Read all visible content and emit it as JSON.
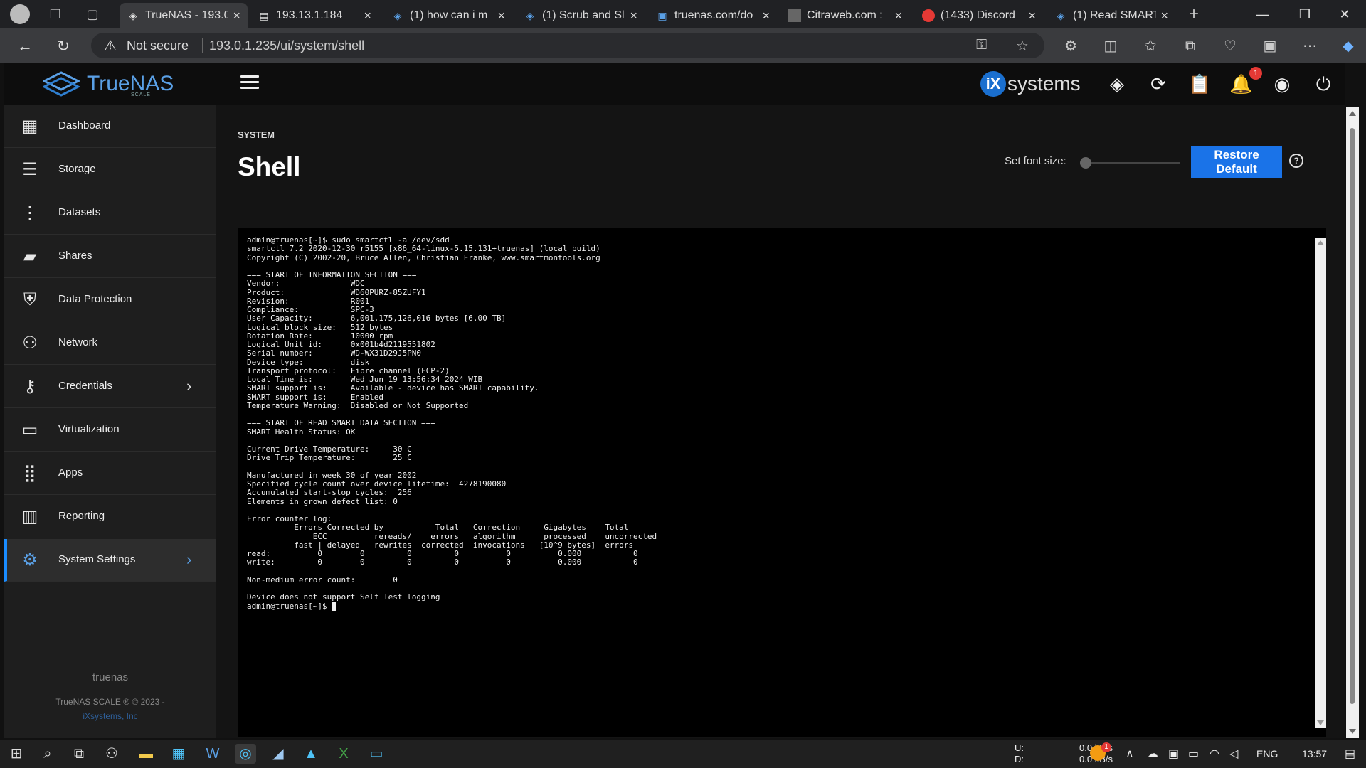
{
  "browser": {
    "tabs": [
      {
        "title": "TrueNAS - 193.0"
      },
      {
        "title": "193.13.1.184"
      },
      {
        "title": "(1) how can i m"
      },
      {
        "title": "(1) Scrub and Sl"
      },
      {
        "title": "truenas.com/do"
      },
      {
        "title": "Citraweb.com :"
      },
      {
        "title": "(1433) Discord"
      },
      {
        "title": "(1) Read SMART"
      }
    ],
    "not_secure": "Not secure",
    "url": "193.0.1.235/ui/system/shell"
  },
  "app": {
    "brand": "TrueNAS",
    "brand_sub": "SCALE",
    "partner_mark": "iX",
    "partner_text": "systems",
    "notification_count": "1"
  },
  "sidebar": {
    "items": [
      {
        "label": "Dashboard"
      },
      {
        "label": "Storage"
      },
      {
        "label": "Datasets"
      },
      {
        "label": "Shares"
      },
      {
        "label": "Data Protection"
      },
      {
        "label": "Network"
      },
      {
        "label": "Credentials"
      },
      {
        "label": "Virtualization"
      },
      {
        "label": "Apps"
      },
      {
        "label": "Reporting"
      },
      {
        "label": "System Settings"
      }
    ],
    "hostname": "truenas",
    "copyright": "TrueNAS SCALE ® © 2023 -",
    "company": "iXsystems, Inc"
  },
  "page": {
    "section": "SYSTEM",
    "title": "Shell",
    "font_size_label": "Set font size:",
    "font_size_level": 0,
    "restore_label": "Restore Default",
    "help_glyph": "?"
  },
  "terminal": {
    "output": "admin@truenas[~]$ sudo smartctl -a /dev/sdd\nsmartctl 7.2 2020-12-30 r5155 [x86_64-linux-5.15.131+truenas] (local build)\nCopyright (C) 2002-20, Bruce Allen, Christian Franke, www.smartmontools.org\n\n=== START OF INFORMATION SECTION ===\nVendor:               WDC\nProduct:              WD60PURZ-85ZUFY1\nRevision:             R001\nCompliance:           SPC-3\nUser Capacity:        6,001,175,126,016 bytes [6.00 TB]\nLogical block size:   512 bytes\nRotation Rate:        10000 rpm\nLogical Unit id:      0x001b4d2119551802\nSerial number:        WD-WX31D29J5PN0\nDevice type:          disk\nTransport protocol:   Fibre channel (FCP-2)\nLocal Time is:        Wed Jun 19 13:56:34 2024 WIB\nSMART support is:     Available - device has SMART capability.\nSMART support is:     Enabled\nTemperature Warning:  Disabled or Not Supported\n\n=== START OF READ SMART DATA SECTION ===\nSMART Health Status: OK\n\nCurrent Drive Temperature:     30 C\nDrive Trip Temperature:        25 C\n\nManufactured in week 30 of year 2002\nSpecified cycle count over device lifetime:  4278190080\nAccumulated start-stop cycles:  256\nElements in grown defect list: 0\n\nError counter log:\n          Errors Corrected by           Total   Correction     Gigabytes    Total\n              ECC          rereads/    errors   algorithm      processed    uncorrected\n          fast | delayed   rewrites  corrected  invocations   [10^9 bytes]  errors\nread:          0        0         0         0          0          0.000           0\nwrite:         0        0         0         0          0          0.000           0\n\nNon-medium error count:        0\n\nDevice does not support Self Test logging\nadmin@truenas[~]$ "
  },
  "taskbar": {
    "upload_label": "U:",
    "download_label": "D:",
    "upload_rate": "0.0 kB/s",
    "download_rate": "0.0 kB/s",
    "language": "ENG",
    "time": "13:57",
    "tray_badge": "1"
  },
  "colors": {
    "accent": "#1a73e8",
    "active_nav": "#5aa0e6",
    "badge": "#e53935"
  }
}
